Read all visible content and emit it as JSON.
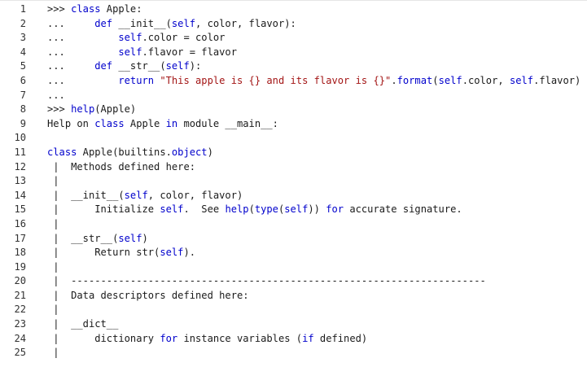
{
  "lines": [
    {
      "n": "1",
      "tokens": [
        {
          "t": ">>> ",
          "c": ""
        },
        {
          "t": "class",
          "c": "kw"
        },
        {
          "t": " Apple:",
          "c": ""
        }
      ]
    },
    {
      "n": "2",
      "tokens": [
        {
          "t": "...     ",
          "c": ""
        },
        {
          "t": "def",
          "c": "kw"
        },
        {
          "t": " __init__(",
          "c": ""
        },
        {
          "t": "self",
          "c": "kw"
        },
        {
          "t": ", color, flavor):",
          "c": ""
        }
      ]
    },
    {
      "n": "3",
      "tokens": [
        {
          "t": "...         ",
          "c": ""
        },
        {
          "t": "self",
          "c": "kw"
        },
        {
          "t": ".color = color",
          "c": ""
        }
      ]
    },
    {
      "n": "4",
      "tokens": [
        {
          "t": "...         ",
          "c": ""
        },
        {
          "t": "self",
          "c": "kw"
        },
        {
          "t": ".flavor = flavor",
          "c": ""
        }
      ]
    },
    {
      "n": "5",
      "tokens": [
        {
          "t": "...     ",
          "c": ""
        },
        {
          "t": "def",
          "c": "kw"
        },
        {
          "t": " __str__(",
          "c": ""
        },
        {
          "t": "self",
          "c": "kw"
        },
        {
          "t": "):",
          "c": ""
        }
      ]
    },
    {
      "n": "6",
      "tokens": [
        {
          "t": "...         ",
          "c": ""
        },
        {
          "t": "return",
          "c": "kw"
        },
        {
          "t": " ",
          "c": ""
        },
        {
          "t": "\"This apple is {} and its flavor is {}\"",
          "c": "str"
        },
        {
          "t": ".",
          "c": ""
        },
        {
          "t": "format",
          "c": "kw"
        },
        {
          "t": "(",
          "c": ""
        },
        {
          "t": "self",
          "c": "kw"
        },
        {
          "t": ".color, ",
          "c": ""
        },
        {
          "t": "self",
          "c": "kw"
        },
        {
          "t": ".flavor)",
          "c": ""
        }
      ]
    },
    {
      "n": "7",
      "tokens": [
        {
          "t": "...",
          "c": ""
        }
      ]
    },
    {
      "n": "8",
      "tokens": [
        {
          "t": ">>> ",
          "c": ""
        },
        {
          "t": "help",
          "c": "kw"
        },
        {
          "t": "(Apple)",
          "c": ""
        }
      ]
    },
    {
      "n": "9",
      "tokens": [
        {
          "t": "Help on ",
          "c": ""
        },
        {
          "t": "class",
          "c": "kw"
        },
        {
          "t": " Apple ",
          "c": ""
        },
        {
          "t": "in",
          "c": "kw"
        },
        {
          "t": " module __main__:",
          "c": ""
        }
      ]
    },
    {
      "n": "10",
      "tokens": []
    },
    {
      "n": "11",
      "tokens": [
        {
          "t": "class",
          "c": "kw"
        },
        {
          "t": " Apple(builtins.",
          "c": ""
        },
        {
          "t": "object",
          "c": "kw"
        },
        {
          "t": ")",
          "c": ""
        }
      ]
    },
    {
      "n": "12",
      "tokens": [
        {
          "t": " |  Methods defined here:",
          "c": ""
        }
      ]
    },
    {
      "n": "13",
      "tokens": [
        {
          "t": " |",
          "c": ""
        }
      ]
    },
    {
      "n": "14",
      "tokens": [
        {
          "t": " |  __init__(",
          "c": ""
        },
        {
          "t": "self",
          "c": "kw"
        },
        {
          "t": ", color, flavor)",
          "c": ""
        }
      ]
    },
    {
      "n": "15",
      "tokens": [
        {
          "t": " |      Initialize ",
          "c": ""
        },
        {
          "t": "self",
          "c": "kw"
        },
        {
          "t": ".  See ",
          "c": ""
        },
        {
          "t": "help",
          "c": "kw"
        },
        {
          "t": "(",
          "c": ""
        },
        {
          "t": "type",
          "c": "kw"
        },
        {
          "t": "(",
          "c": ""
        },
        {
          "t": "self",
          "c": "kw"
        },
        {
          "t": ")) ",
          "c": ""
        },
        {
          "t": "for",
          "c": "kw"
        },
        {
          "t": " accurate signature.",
          "c": ""
        }
      ]
    },
    {
      "n": "16",
      "tokens": [
        {
          "t": " |",
          "c": ""
        }
      ]
    },
    {
      "n": "17",
      "tokens": [
        {
          "t": " |  __str__(",
          "c": ""
        },
        {
          "t": "self",
          "c": "kw"
        },
        {
          "t": ")",
          "c": ""
        }
      ]
    },
    {
      "n": "18",
      "tokens": [
        {
          "t": " |      Return str(",
          "c": ""
        },
        {
          "t": "self",
          "c": "kw"
        },
        {
          "t": ").",
          "c": ""
        }
      ]
    },
    {
      "n": "19",
      "tokens": [
        {
          "t": " |",
          "c": ""
        }
      ]
    },
    {
      "n": "20",
      "tokens": [
        {
          "t": " |  ----------------------------------------------------------------------",
          "c": ""
        }
      ]
    },
    {
      "n": "21",
      "tokens": [
        {
          "t": " |  Data descriptors defined here:",
          "c": ""
        }
      ]
    },
    {
      "n": "22",
      "tokens": [
        {
          "t": " |",
          "c": ""
        }
      ]
    },
    {
      "n": "23",
      "tokens": [
        {
          "t": " |  __dict__",
          "c": ""
        }
      ]
    },
    {
      "n": "24",
      "tokens": [
        {
          "t": " |      dictionary ",
          "c": ""
        },
        {
          "t": "for",
          "c": "kw"
        },
        {
          "t": " instance variables (",
          "c": ""
        },
        {
          "t": "if",
          "c": "kw"
        },
        {
          "t": " defined)",
          "c": ""
        }
      ]
    },
    {
      "n": "25",
      "tokens": [
        {
          "t": " |",
          "c": ""
        }
      ]
    }
  ],
  "colors": {
    "keyword": "#0000cc",
    "string": "#a31515",
    "text": "#1a1a1a",
    "line_number": "#333333",
    "background": "#ffffff"
  }
}
